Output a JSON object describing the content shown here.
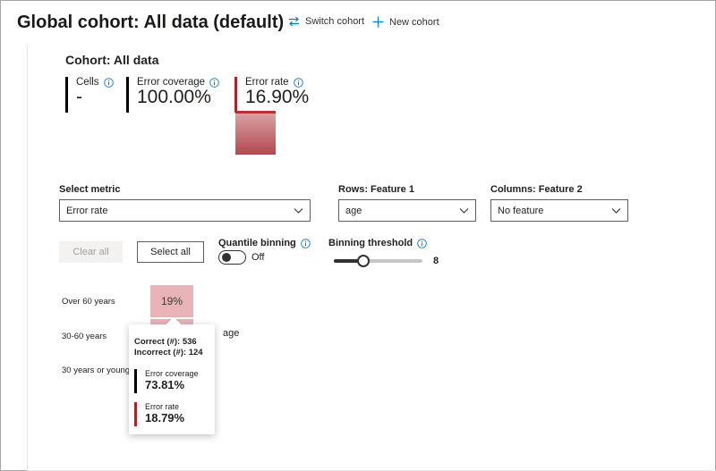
{
  "header": {
    "title": "Global cohort: All data (default)",
    "switch_cohort_label": "Switch cohort",
    "new_cohort_label": "New cohort"
  },
  "cohort": {
    "title": "Cohort: All data",
    "metrics": [
      {
        "label": "Cells",
        "value": "-"
      },
      {
        "label": "Error coverage",
        "value": "100.00%"
      },
      {
        "label": "Error rate",
        "value": "16.90%"
      }
    ],
    "error_rate_bar_fraction": 0.169
  },
  "controls": {
    "select_metric": {
      "label": "Select metric",
      "value": "Error rate"
    },
    "rows_feature": {
      "label": "Rows: Feature 1",
      "value": "age"
    },
    "columns_feature": {
      "label": "Columns: Feature 2",
      "value": "No feature"
    },
    "clear_all_label": "Clear all",
    "select_all_label": "Select all",
    "quantile_binning": {
      "label": "Quantile binning",
      "state_text": "Off",
      "on": false
    },
    "binning_threshold": {
      "label": "Binning threshold",
      "value": "8",
      "fraction": 0.33
    }
  },
  "heatmap": {
    "row_labels": [
      "Over 60 years",
      "30-60 years",
      "30 years or younger"
    ],
    "cell_values": [
      "19%",
      "",
      ""
    ],
    "axis_label": "age",
    "colors": {
      "cell": "#e8b3b6"
    }
  },
  "tooltip": {
    "correct": "Correct (#): 536",
    "incorrect": "Incorrect (#): 124",
    "error_coverage": {
      "label": "Error coverage",
      "value": "73.81%"
    },
    "error_rate": {
      "label": "Error rate",
      "value": "18.79%"
    }
  },
  "colors": {
    "error_bar": "#b82f34",
    "accent_red": "#a4262c",
    "link_blue": "#0078d4"
  },
  "icons": {
    "switch_cohort": "switch-arrows-icon",
    "new_cohort": "plus-icon",
    "info": "info-icon",
    "dropdown": "chevron-down-icon"
  }
}
